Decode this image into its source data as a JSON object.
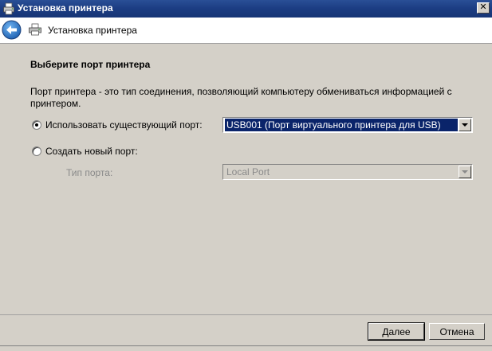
{
  "window": {
    "title": "Установка принтера",
    "close_glyph": "✕"
  },
  "header": {
    "title": "Установка принтера"
  },
  "main": {
    "section_title": "Выберите порт принтера",
    "description": "Порт принтера - это тип соединения, позволяющий компьютеру обмениваться информацией с принтером.",
    "use_existing": {
      "label": "Использовать существующий порт:",
      "checked": true,
      "selected_value": "USB001 (Порт виртуального принтера для USB)"
    },
    "create_new": {
      "label": "Создать новый порт:",
      "checked": false,
      "port_type_label": "Тип порта:",
      "port_type_value": "Local Port"
    }
  },
  "footer": {
    "next_label": "Далее",
    "cancel_label": "Отмена"
  },
  "colors": {
    "titlebar": "#1b3c82",
    "selection": "#0a246a",
    "dialog_bg": "#d4d0c8",
    "back_arrow": "#1d6fc2"
  }
}
